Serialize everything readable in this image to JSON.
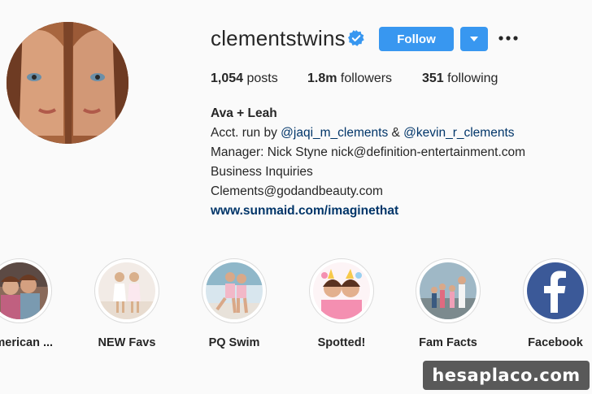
{
  "profile": {
    "username": "clementstwins",
    "verified_icon": "verified-badge-icon",
    "follow_label": "Follow",
    "stats": [
      {
        "value": "1,054",
        "label": "posts"
      },
      {
        "value": "1.8m",
        "label": "followers"
      },
      {
        "value": "351",
        "label": "following"
      }
    ],
    "bio": {
      "name": "Ava + Leah",
      "acct_prefix": "Acct. run by ",
      "mention1": "@jaqi_m_clements",
      "amp": " & ",
      "mention2": "@kevin_r_clements",
      "line_manager": "Manager: Nick Styne nick@definition-entertainment.com",
      "line_business": "Business Inquiries",
      "line_email": "Clements@godandbeauty.com",
      "website": "www.sunmaid.com/imaginethat"
    }
  },
  "highlights": [
    {
      "label": "American ..."
    },
    {
      "label": "NEW Favs"
    },
    {
      "label": "PQ Swim"
    },
    {
      "label": "Spotted!"
    },
    {
      "label": "Fam Facts"
    },
    {
      "label": "Facebook"
    }
  ],
  "colors": {
    "accent": "#3897f0",
    "link": "#003569",
    "background": "#fafafa",
    "facebook": "#3b5998"
  },
  "watermark": "hesaplaco.com"
}
